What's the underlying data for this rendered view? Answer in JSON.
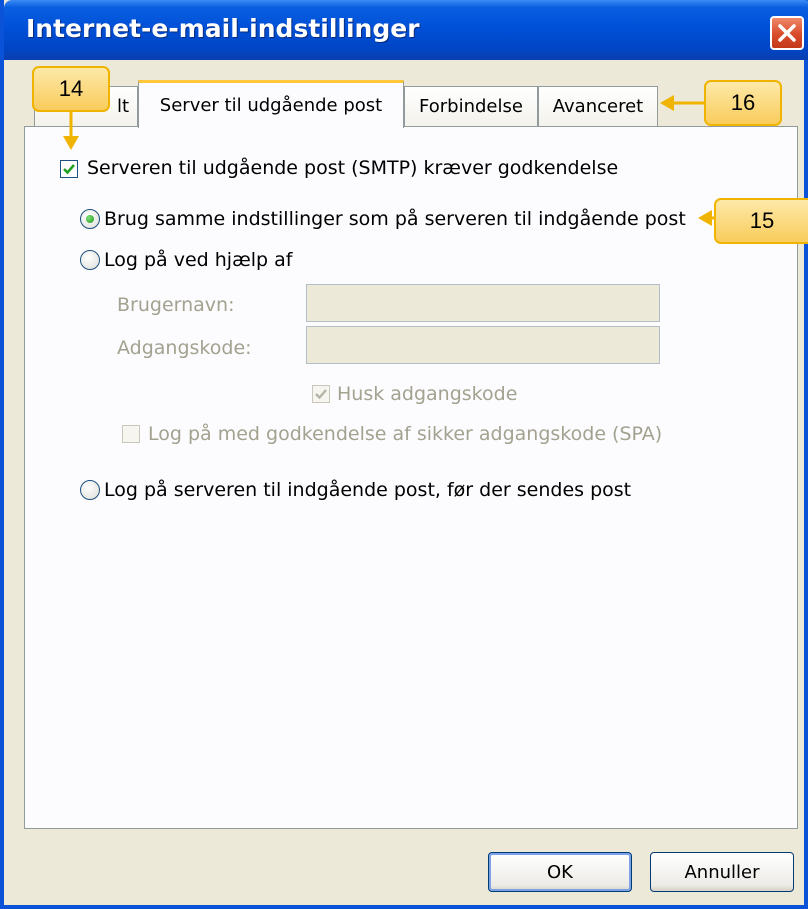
{
  "window": {
    "title": "Internet-e-mail-indstillinger"
  },
  "tabs": [
    {
      "label": "lt"
    },
    {
      "label": "Server til udgående post"
    },
    {
      "label": "Forbindelse"
    },
    {
      "label": "Avanceret"
    }
  ],
  "smtp": {
    "requires_auth_label": "Serveren til udgående post (SMTP) kræver godkendelse",
    "requires_auth_checked": true
  },
  "auth_options": {
    "same_settings_label": "Brug samme indstillinger som på serveren til indgående post",
    "logon_label": "Log på ved hjælp af",
    "logon_before_label": "Log på serveren til indgående post, før der sendes post",
    "selected": "same_settings"
  },
  "credentials": {
    "username_label": "Brugernavn:",
    "password_label": "Adgangskode:",
    "username_value": "",
    "password_value": "",
    "remember_label": "Husk adgangskode",
    "remember_checked": true,
    "spa_label": "Log på med godkendelse af sikker adgangskode (SPA)",
    "spa_checked": false
  },
  "buttons": {
    "ok": "OK",
    "cancel": "Annuller"
  },
  "callouts": {
    "c14": "14",
    "c15": "15",
    "c16": "16"
  },
  "colors": {
    "titlebar": "#0050d8",
    "callout_fill": "#fbd87a",
    "callout_border": "#f0b400",
    "close_button": "#d84a2a"
  },
  "icons": {
    "close": "close-icon",
    "check": "check-icon"
  }
}
